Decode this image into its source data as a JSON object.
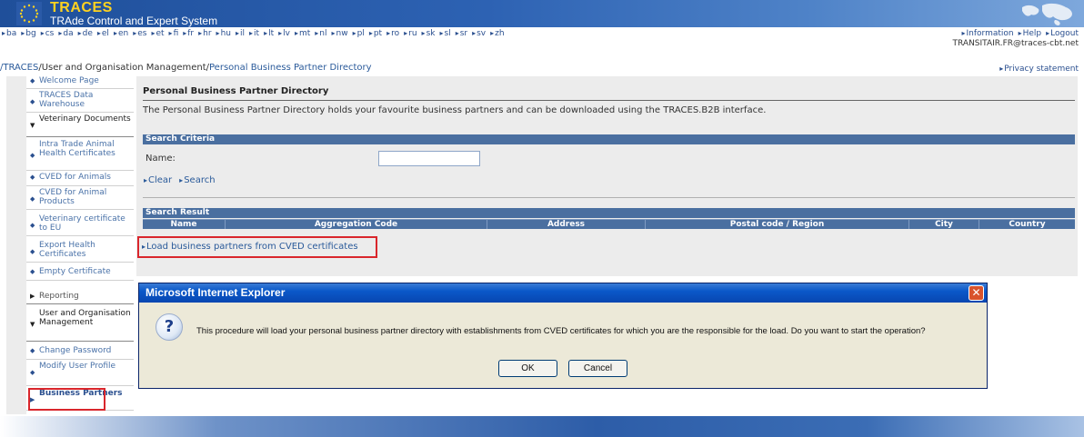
{
  "banner": {
    "app_name": "TRACES",
    "app_full_name": "TRAde Control and Expert System"
  },
  "languages": [
    "ba",
    "bg",
    "cs",
    "da",
    "de",
    "el",
    "en",
    "es",
    "et",
    "fi",
    "fr",
    "hr",
    "hu",
    "il",
    "it",
    "lt",
    "lv",
    "mt",
    "nl",
    "nw",
    "pl",
    "pt",
    "ro",
    "ru",
    "sk",
    "sl",
    "sr",
    "sv",
    "zh"
  ],
  "top_links": {
    "information": "Information",
    "help": "Help",
    "logout": "Logout",
    "user_email": "TRANSITAIR.FR@traces-cbt.net"
  },
  "breadcrumb": {
    "root": "/TRACES",
    "section": "/User and Organisation Management/",
    "current": "Personal Business Partner Directory"
  },
  "privacy_link": "Privacy statement",
  "sidebar": {
    "welcome": "Welcome Page",
    "data_warehouse": "TRACES Data Warehouse",
    "vet_docs": "Veterinary Documents",
    "intra_trade": "Intra Trade Animal Health Certificates",
    "cved_animals": "CVED for Animals",
    "cved_products": "CVED for Animal Products",
    "vet_cert_eu": "Veterinary certificate to EU",
    "export_health": "Export Health Certificates",
    "empty_cert": "Empty Certificate",
    "reporting": "Reporting",
    "user_org": "User and Organisation Management",
    "change_password": "Change Password",
    "modify_profile": "Modify User Profile",
    "business_partners": "Business Partners"
  },
  "main": {
    "title": "Personal Business Partner Directory",
    "intro": "The Personal Business Partner Directory holds your favourite business partners and can be downloaded using the TRACES.B2B interface.",
    "search_criteria_header": "Search Criteria",
    "name_label": "Name:",
    "name_value": "",
    "clear_label": "Clear",
    "search_label": "Search",
    "search_result_header": "Search Result",
    "columns": [
      "Name",
      "Aggregation Code",
      "Address",
      "Postal code / Region",
      "City",
      "Country"
    ],
    "load_link": "Load business partners from CVED certificates"
  },
  "dialog": {
    "title": "Microsoft Internet Explorer",
    "message": "This procedure will load your personal business partner directory with establishments from CVED certificates for which you are the responsible for the load. Do you want to start the operation?",
    "ok_label": "OK",
    "cancel_label": "Cancel",
    "icon": "question-icon"
  },
  "colors": {
    "header_blue": "#4a6fa0",
    "highlight_red": "#d9262c",
    "link_blue": "#2a5a9a"
  }
}
